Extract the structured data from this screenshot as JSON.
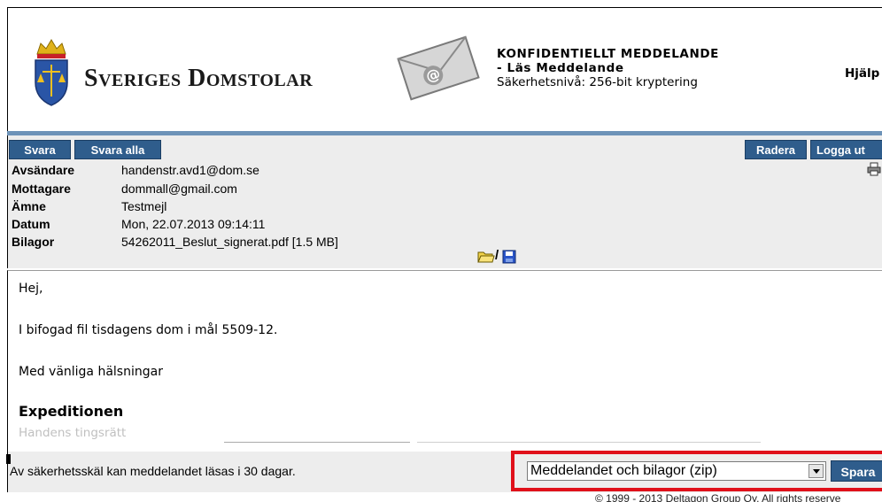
{
  "header": {
    "logo_text": "Sveriges Domstolar",
    "title_line1": "KONFIDENTIELLT MEDDELANDE",
    "title_line2": "- Läs Meddelande",
    "security_level": "Säkerhetsnivå: 256-bit kryptering",
    "help_label": "Hjälp"
  },
  "toolbar": {
    "reply_label": "Svara",
    "reply_all_label": "Svara alla",
    "delete_label": "Radera",
    "logout_label": "Logga ut"
  },
  "message": {
    "fields": [
      {
        "label": "Avsändare",
        "value": "handenstr.avd1@dom.se"
      },
      {
        "label": "Mottagare",
        "value": "dommall@gmail.com"
      },
      {
        "label": "Ämne",
        "value": "Testmejl"
      },
      {
        "label": "Datum",
        "value": "Mon, 22.07.2013 09:14:11"
      },
      {
        "label": "Bilagor",
        "value": "54262011_Beslut_signerat.pdf [1.5 MB]"
      }
    ],
    "body": {
      "greeting": "Hej,",
      "line": "I bifogad fil tisdagens dom i mål 5509-12.",
      "closing": "Med vänliga hälsningar",
      "signature_name": "Expeditionen",
      "signature_court": "Handens tingsrätt"
    }
  },
  "footer": {
    "notice": "Av säkerhetsskäl kan meddelandet läsas i 30 dagar.",
    "format_selected": "Meddelandet och bilagor (zip)",
    "save_label": "Spara",
    "copyright": "© 1999 - 2013 Deltagon Group Oy. All rights reserve"
  },
  "colors": {
    "button_bg": "#2f5d8c",
    "divider_blue": "#6d93b8",
    "highlight_red": "#e0101a",
    "panel_bg": "#ededed"
  },
  "icons": [
    "crown-shield-icon",
    "envelope-at-icon",
    "printer-icon",
    "folder-open-icon",
    "save-disk-icon",
    "chevron-down-icon"
  ]
}
